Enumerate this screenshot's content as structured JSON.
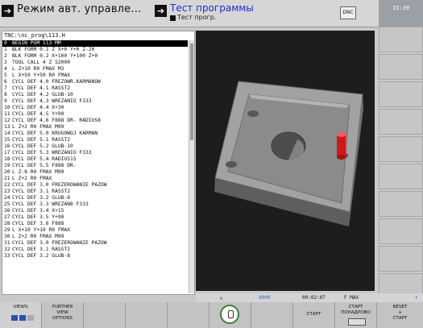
{
  "header": {
    "mode1_label": "Режим авт. управле…",
    "mode2_label": "Тест программы",
    "mode2_sub": "Тест прогр.",
    "dnc": "DNC",
    "time": "15:39"
  },
  "program": {
    "path": "TNC:\\nc_prog\\113.H",
    "lines": [
      {
        "n": "0",
        "t": "BEGIN PGM 113 MM"
      },
      {
        "n": "1",
        "t": "BLK FORM 0.1 Z X+0 Y+0 Z-20"
      },
      {
        "n": "2",
        "t": "BLK FORM 0.2  X+100  Y+100  Z+0"
      },
      {
        "n": "3",
        "t": "TOOL CALL 4 Z S2000"
      },
      {
        "n": "4",
        "t": "L  Z+10 R0 FMAX M3"
      },
      {
        "n": "5",
        "t": "L  X+50  Y+50 R0 FMAX"
      },
      {
        "n": "6",
        "t": "CYCL DEF 4.0 FREZOWR.KARMANOW"
      },
      {
        "n": "7",
        "t": "CYCL DEF 4.1 RASST2"
      },
      {
        "n": "8",
        "t": "CYCL DEF 4.2 GLUB-10"
      },
      {
        "n": "9",
        "t": "CYCL DEF 4.3 WREZANIO F333"
      },
      {
        "n": "10",
        "t": "CYCL DEF 4.4 X+30"
      },
      {
        "n": "11",
        "t": "CYCL DEF 4.5 Y+90"
      },
      {
        "n": "12",
        "t": "CYCL DEF 4.6 F888 DR- RADIUS8"
      },
      {
        "n": "13",
        "t": "L  Z+2 R0 FMAX M99"
      },
      {
        "n": "14",
        "t": "CYCL DEF 5.0 KRUGOWOJ KARMAN"
      },
      {
        "n": "15",
        "t": "CYCL DEF 5.1 RASST2"
      },
      {
        "n": "16",
        "t": "CYCL DEF 5.2 GLUB-10"
      },
      {
        "n": "17",
        "t": "CYCL DEF 5.3 WREZANIO F333"
      },
      {
        "n": "18",
        "t": "CYCL DEF 5.4 RADIUS15"
      },
      {
        "n": "19",
        "t": "CYCL DEF 5.5 F888 DR-"
      },
      {
        "n": "20",
        "t": "L  Z-8 R0 FMAX M99"
      },
      {
        "n": "21",
        "t": "L  Z+2 R0 FMAX"
      },
      {
        "n": "22",
        "t": "CYCL DEF 3.0 FREZEROWANIE PAZOW"
      },
      {
        "n": "23",
        "t": "CYCL DEF 3.1 RASST2"
      },
      {
        "n": "24",
        "t": "CYCL DEF 3.2 GLUB-8"
      },
      {
        "n": "25",
        "t": "CYCL DEF 3.3 WREZAN8 F333"
      },
      {
        "n": "26",
        "t": "CYCL DEF 3.4 X+15"
      },
      {
        "n": "27",
        "t": "CYCL DEF 3.5 Y+90"
      },
      {
        "n": "28",
        "t": "CYCL DEF 3.6 F888"
      },
      {
        "n": "29",
        "t": "L  X+10  Y+10 R0 FMAX"
      },
      {
        "n": "30",
        "t": "L  Z+2 R0 FMAX M99"
      },
      {
        "n": "31",
        "t": "CYCL DEF 3.0 FREZEROWANIE PAZOW"
      },
      {
        "n": "32",
        "t": "CYCL DEF 3.1 RASST2"
      },
      {
        "n": "33",
        "t": "CYCL DEF 3.2 GLUB-8"
      }
    ]
  },
  "status": {
    "indicator": "0000",
    "time": "00:02:07",
    "feed": "F MAX"
  },
  "softkeys": {
    "views": "VIEWS",
    "further_1": "FURTHER",
    "further_2": "VIEW",
    "further_3": "OPTIONS",
    "start": "СТАРТ",
    "start_single_1": "СТАРТ",
    "start_single_2": "ПОКАДРОВО",
    "reset_1": "RESET",
    "reset_2": "+",
    "reset_3": "СТАРТ"
  },
  "colors": {
    "accent": "#1a2fd0",
    "tool": "#d8141a",
    "part": "#8d8d8d"
  }
}
